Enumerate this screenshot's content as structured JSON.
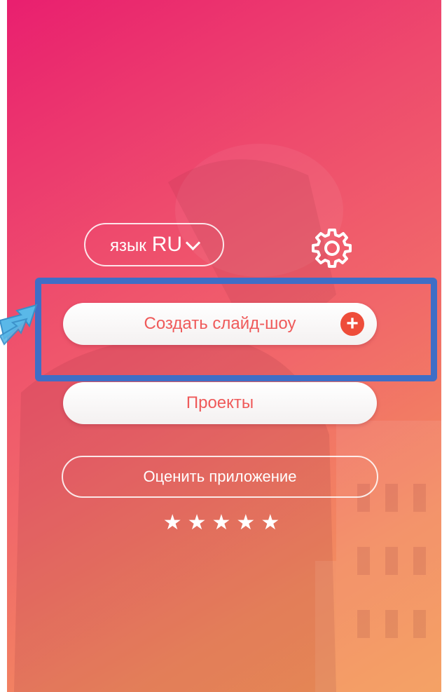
{
  "language": {
    "prefix": "язык",
    "code": "RU",
    "chevron_icon": "chevron-down-icon"
  },
  "settings": {
    "icon": "gear-icon"
  },
  "buttons": {
    "create_slideshow": "Создать слайд-шоу",
    "create_icon": "plus-icon",
    "projects": "Проекты",
    "rate_app": "Оценить приложение"
  },
  "rating": {
    "stars": "★★★★★",
    "star_count": 5
  },
  "colors": {
    "gradient_start": "#e91f6f",
    "gradient_end": "#f39a58",
    "button_text": "#ef5a5a",
    "plus_badge": "#ee4d3a",
    "highlight": "#3f6ec6",
    "pointer_arrow": "#5ab8e8"
  }
}
